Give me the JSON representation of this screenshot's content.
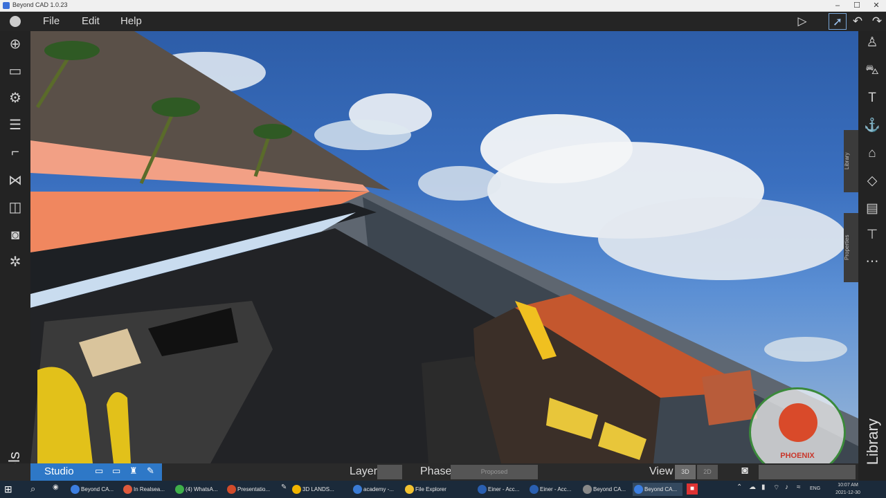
{
  "window": {
    "title": "Beyond CAD 1.0.23",
    "controls": [
      "–",
      "☐",
      "✕"
    ]
  },
  "menu": {
    "items": [
      "File",
      "Edit",
      "Help"
    ]
  },
  "left_toolbar": {
    "label": "Tools",
    "icons": [
      "add-icon",
      "paint-roller-icon",
      "gear-icon",
      "layers-icon",
      "bracket-icon",
      "network-icon",
      "cube-icon",
      "camera-icon",
      "settings-icon"
    ]
  },
  "right_toolbar": {
    "label": "Library",
    "icons": [
      "person-icon",
      "car-icon",
      "streetlight-icon",
      "anchor-icon",
      "house-icon",
      "diamond-sign-icon",
      "bus-icon",
      "traffic-light-icon",
      "more-icon"
    ]
  },
  "side_tabs": {
    "library": "Library",
    "properties": "Properties"
  },
  "bottom": {
    "studio_label": "Studio",
    "layer_label": "Layer",
    "phase_label": "Phase",
    "phase_value": "Proposed",
    "view_label": "View",
    "view_options": [
      "3D",
      "2D"
    ]
  },
  "taskbar": {
    "items": [
      {
        "label": "Beyond CA...",
        "color": "#3c7ee0"
      },
      {
        "label": "In Realsea...",
        "color": "#e05a3c"
      },
      {
        "label": "(4) WhatsA...",
        "color": "#3fb04a"
      },
      {
        "label": "Presentatio...",
        "color": "#d14b2a"
      },
      {
        "label": "3D LANDS...",
        "color": "#f0b400"
      },
      {
        "label": "academy -...",
        "color": "#3a7bd5"
      },
      {
        "label": "File Explorer",
        "color": "#f2c230"
      },
      {
        "label": "Einer - Acc...",
        "color": "#2a5fb0"
      },
      {
        "label": "Einer - Acc...",
        "color": "#2a5fb0"
      },
      {
        "label": "Beyond CA...",
        "color": "#888888"
      },
      {
        "label": "Beyond CA...",
        "color": "#3c7ee0"
      }
    ],
    "tray_lang": "ENG",
    "time": "10:07 AM",
    "date": "2021-12-30"
  },
  "watermark": {
    "text": "PHOENIX"
  }
}
